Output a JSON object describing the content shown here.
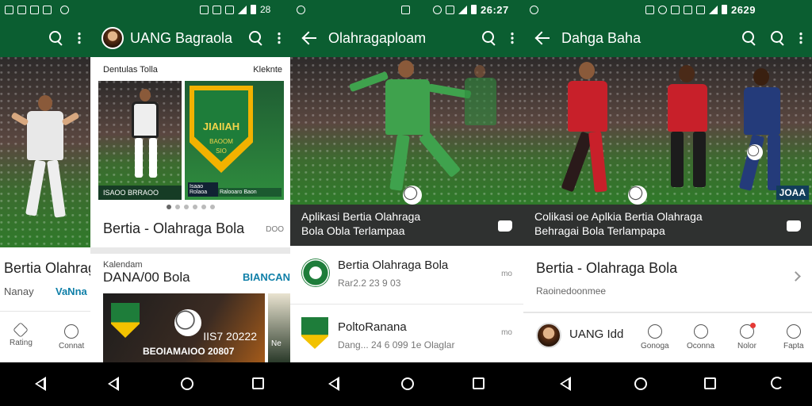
{
  "status_bar": {
    "time_center": "26:27",
    "time_right": "2629",
    "battery_left": "28"
  },
  "panel1": {
    "article_title": "Bertia Olahraga",
    "meta_left": "Nanay",
    "meta_right": "VaNna",
    "nav": [
      "Rating",
      "Connat"
    ]
  },
  "panel2": {
    "app_title": "UANG Bagraola",
    "card_label_left": "Dentulas Tolla",
    "card_label_right": "Kleknte",
    "banner_caption_top": "ISAOO BRRAOO",
    "banner_caption_mid": "Isaao Rolaoa",
    "banner_caption_right": "Ralooaro Baon",
    "badge_text": "JIAIIAH",
    "badge_sub_1": "BAOOM",
    "badge_sub_2": "SIO",
    "main_title": "Bertia - Olahraga Bola",
    "main_title_meta": "DOO",
    "section_small": "Kalendam",
    "section_large": "DANA/00 Bola",
    "section_link": "BIANCAN",
    "promo_line1": "IIS7 20222",
    "promo_line2": "BEOIAMAIOO 20807",
    "promo_side": "Ne"
  },
  "panel3": {
    "app_title": "Olahragaploam",
    "caption_line1": "Aplikasi Bertia Olahraga",
    "caption_line2": "Bola Obla Terlampaa",
    "rows": [
      {
        "title": "Bertia Olahraga Bola",
        "subtitle": "Rar2.2 23 9 03",
        "meta": "mo"
      },
      {
        "title": "PoltoRanana",
        "subtitle": "Dang... 24 6 099 1e Olaglar",
        "meta": "mo"
      }
    ]
  },
  "panel4": {
    "app_title": "Dahga Baha",
    "caption_line1": "Colikasi oe Aplkia Bertia Olahraga",
    "caption_line2": "Behragai Bola Terlampapa",
    "watermark": "JOAA",
    "list_title": "Bertia - Olahraga Bola",
    "list_subtitle": "Raoinedoonmee",
    "profile_name": "UANG Idd",
    "nav": [
      "Gonoga",
      "Oconna",
      "Nolor",
      "Fapta"
    ]
  }
}
